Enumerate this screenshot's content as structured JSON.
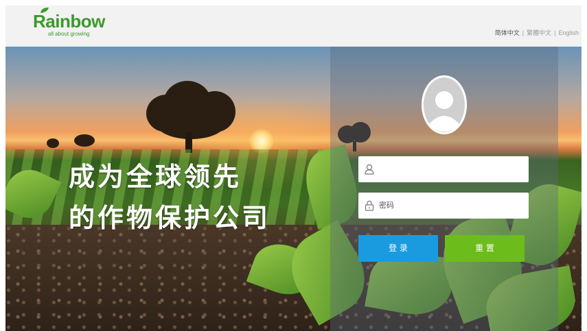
{
  "header": {
    "logo": {
      "brand": "Rainbow",
      "tagline": "all about growing",
      "brand_color": "#3a9a2a"
    },
    "languages": [
      {
        "label": "简体中文",
        "active": true
      },
      {
        "label": "繁體中文",
        "active": false
      },
      {
        "label": "English",
        "active": false
      }
    ],
    "separator": "|"
  },
  "hero": {
    "slogan_line1": "成为全球领先",
    "slogan_line2": "的作物保护公司"
  },
  "login": {
    "avatar_icon": "user-avatar-icon",
    "username": {
      "value": "",
      "placeholder": "",
      "icon": "user-icon"
    },
    "password": {
      "value": "",
      "placeholder": "密码",
      "icon": "lock-icon"
    },
    "login_label": "登 录",
    "reset_label": "重 置",
    "colors": {
      "login": "#1a9be0",
      "reset": "#6cbc1c"
    }
  }
}
